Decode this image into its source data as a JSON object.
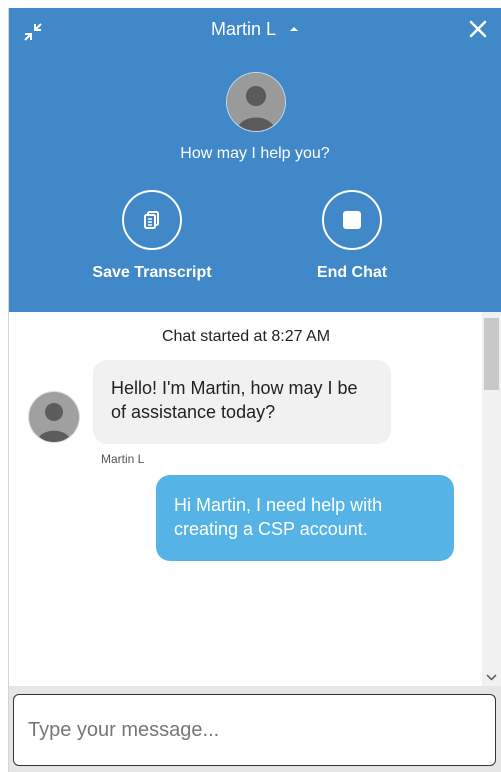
{
  "header": {
    "agent_name": "Martin L",
    "greeting": "How may I help you?",
    "actions": [
      {
        "label": "Save Transcript",
        "icon": "save-transcript-icon"
      },
      {
        "label": "End Chat",
        "icon": "stop-icon"
      }
    ],
    "bg_color": "#4088c7"
  },
  "conversation": {
    "started_text": "Chat started at 8:27 AM",
    "messages": [
      {
        "from": "agent",
        "sender": "Martin L",
        "text": "Hello! I'm Martin, how may I be of assistance today?"
      },
      {
        "from": "user",
        "text": "Hi Martin, I need help with creating a CSP account."
      }
    ],
    "user_bubble_color": "#55b4e5",
    "agent_bubble_color": "#f1f1f1"
  },
  "composer": {
    "placeholder": "Type your message..."
  }
}
